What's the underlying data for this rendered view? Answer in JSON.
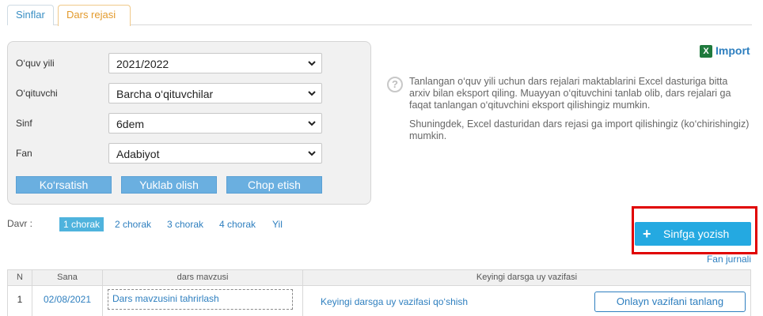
{
  "tabs": [
    {
      "label": "Sinflar"
    },
    {
      "label": "Dars rejasi"
    }
  ],
  "filters": {
    "year": {
      "label": "O‘quv yili",
      "value": "2021/2022"
    },
    "teacher": {
      "label": "O‘qituvchi",
      "value": "Barcha o‘qituvchilar"
    },
    "class": {
      "label": "Sinf",
      "value": "6dem"
    },
    "subject": {
      "label": "Fan",
      "value": "Adabiyot"
    }
  },
  "buttons": {
    "show": "Ko‘rsatish",
    "download": "Yuklab olish",
    "print": "Chop etish"
  },
  "import": {
    "label": "Import",
    "icon": "excel-icon"
  },
  "info": {
    "p1": "Tanlangan o‘quv yili uchun dars rejalari maktablarini Excel dasturiga bitta arxiv bilan eksport qiling. Muayyan o‘qituvchini tanlab olib, dars rejalari ga faqat tanlangan o‘qituvchini eksport qilishingiz mumkin.",
    "p2": "Shuningdek, Excel dasturidan dars rejasi ga import qilishingiz (ko‘chirishingiz) mumkin."
  },
  "period": {
    "label": "Davr :",
    "items": [
      "1 chorak",
      "2 chorak",
      "3 chorak",
      "4 chorak",
      "Yil"
    ],
    "active": "1 chorak"
  },
  "write_button": {
    "plus": "+",
    "label": "Sinfga yozish"
  },
  "fan_journal": "Fan jurnali",
  "table": {
    "headers": [
      "N",
      "Sana",
      "dars mavzusi",
      "Keyingi darsga uy vazifasi"
    ],
    "rows": [
      {
        "n": "1",
        "date": "02/08/2021",
        "topic": "Dars mavzusini tahrirlash",
        "homework": "Keyingi darsga uy vazifasi qo‘shish",
        "online": "Onlayn vazifani tanlang"
      }
    ]
  },
  "colors": {
    "accent": "#24a9e1",
    "link": "#2e7fbf",
    "highlight": "#e00000"
  }
}
